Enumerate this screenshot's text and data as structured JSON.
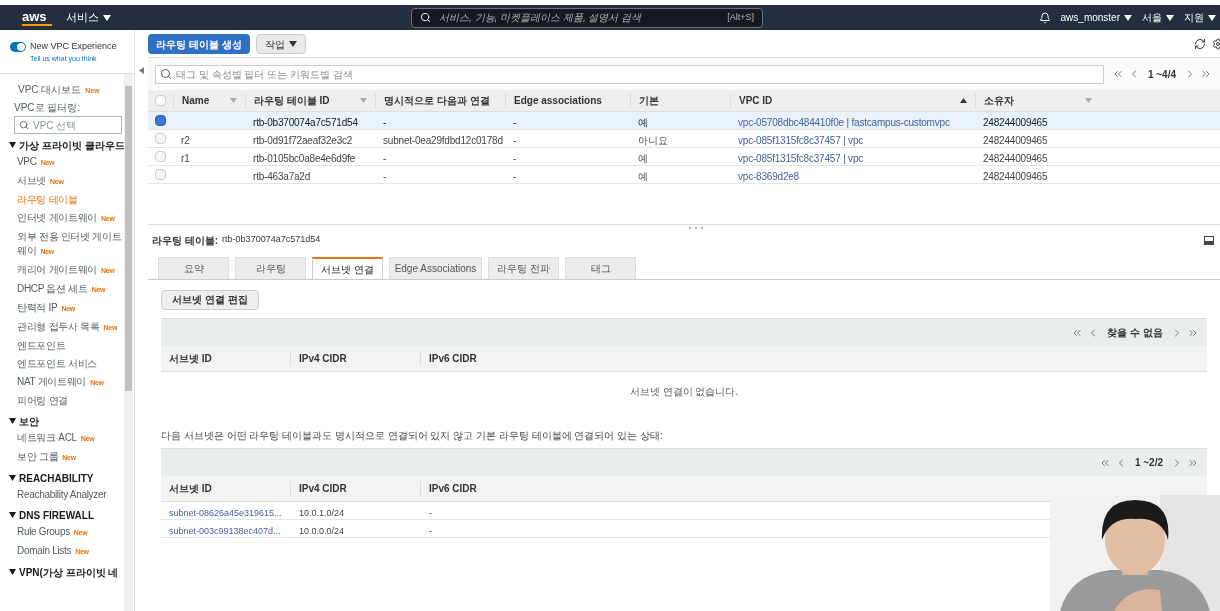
{
  "header": {
    "logo": "aws",
    "services": "서비스",
    "search_placeholder": "서비스, 기능, 마켓플레이스 제품, 설명서 검색",
    "shortcut": "[Alt+S]",
    "user": "aws_monster",
    "region": "서울",
    "support": "지원"
  },
  "sidebar": {
    "toggle": {
      "label": "New VPC Experience",
      "on": true
    },
    "feedback": "Tell us what you think",
    "top_items": [
      {
        "label": "VPC 대시보드",
        "badge": "New"
      }
    ],
    "filter_label": "VPC로 필터링:",
    "filter_placeholder": "VPC 선택",
    "sections": [
      {
        "title": "가상 프라이빗 클라우드",
        "expanded": true,
        "items": [
          {
            "label": "VPC",
            "badge": "New",
            "selected": false
          },
          {
            "label": "서브넷",
            "badge": "New",
            "selected": false
          },
          {
            "label": "라우팅 테이블",
            "selected": true
          },
          {
            "label": "인터넷 게이트웨이",
            "badge": "New",
            "selected": false
          },
          {
            "label": "외부 전용 인터넷 게이트웨이",
            "badge": "New",
            "selected": false
          },
          {
            "label": "캐리어 게이트웨이",
            "badge": "New",
            "selected": false
          },
          {
            "label": "DHCP 옵션 세트",
            "badge": "New",
            "selected": false
          },
          {
            "label": "탄력적 IP",
            "badge": "New",
            "selected": false
          },
          {
            "label": "관리형 접두사 목록",
            "badge": "New",
            "selected": false
          },
          {
            "label": "엔드포인트",
            "selected": false
          },
          {
            "label": "엔드포인트 서비스",
            "selected": false
          },
          {
            "label": "NAT 게이트웨이",
            "badge": "New",
            "selected": false
          },
          {
            "label": "피어링 연결",
            "selected": false
          }
        ]
      },
      {
        "title": "보안",
        "expanded": true,
        "items": [
          {
            "label": "네트워크 ACL",
            "badge": "New",
            "selected": false
          },
          {
            "label": "보안 그룹",
            "badge": "New",
            "selected": false
          }
        ]
      },
      {
        "title": "REACHABILITY",
        "expanded": true,
        "items": [
          {
            "label": "Reachability Analyzer",
            "selected": false
          }
        ]
      },
      {
        "title": "DNS FIREWALL",
        "expanded": true,
        "items": [
          {
            "label": "Rule Groups",
            "badge": "New",
            "selected": false
          },
          {
            "label": "Domain Lists",
            "badge": "New",
            "selected": false
          }
        ]
      },
      {
        "title": "VPN(가상 프라이빗 네",
        "expanded": true
      }
    ]
  },
  "toolbar": {
    "create_button": "라우팅 테이블 생성",
    "actions_button": "작업"
  },
  "filter": {
    "placeholder": "태그 및 속성별 필터 또는 키워드별 검색",
    "pagination": "1 ~4/4"
  },
  "table": {
    "all_selected": false,
    "columns": [
      {
        "label": "Name",
        "menu": true,
        "sorted": false
      },
      {
        "label": "라우팅 테이블 ID",
        "menu": true,
        "sorted": false
      },
      {
        "label": "명시적으로 다음과 연결",
        "menu": false,
        "sorted": false
      },
      {
        "label": "Edge associations",
        "menu": false,
        "sorted": false
      },
      {
        "label": "기본",
        "menu": false,
        "sorted": false
      },
      {
        "label": "VPC ID",
        "menu": false,
        "sorted": true
      },
      {
        "label": "소유자",
        "menu": true,
        "sorted": false
      }
    ],
    "rows": [
      {
        "selected": true,
        "cells": [
          "",
          "rtb-0b370074a7c571d54",
          "-",
          "-",
          "예",
          "vpc-05708dbc484410f0e | fastcampus-customvpc",
          "248244009465"
        ]
      },
      {
        "selected": false,
        "cells": [
          "r2",
          "rtb-0d91f72aeaf32e3c2",
          "subnet-0ea29fdbd12c0178d",
          "-",
          "아니요",
          "vpc-085f1315fc8c37457 | vpc",
          "248244009465"
        ]
      },
      {
        "selected": false,
        "cells": [
          "r1",
          "rtb-0105bc0a8e4e6d9fe",
          "-",
          "-",
          "예",
          "vpc-085f1315fc8c37457 | vpc",
          "248244009465"
        ]
      },
      {
        "selected": false,
        "cells": [
          "",
          "rtb-463a7a2d",
          "-",
          "-",
          "예",
          "vpc-8369d2e8",
          "248244009465"
        ]
      }
    ]
  },
  "detail": {
    "label": "라우팅 테이블:",
    "value": "rtb-0b370074a7c571d54",
    "tabs": [
      {
        "label": "요약",
        "selected": false
      },
      {
        "label": "라우팅",
        "selected": false
      },
      {
        "label": "서브넷 연결",
        "selected": true
      },
      {
        "label": "Edge Associations",
        "selected": false
      },
      {
        "label": "라우팅 전파",
        "selected": false
      },
      {
        "label": "태그",
        "selected": false
      }
    ],
    "edit_button": "서브넷 연결 편집",
    "associated": {
      "pagination": "찾을 수 없음",
      "columns": [
        "서브넷 ID",
        "IPv4 CIDR",
        "IPv6 CIDR"
      ],
      "empty_message": "서브넷 연결이 없습니다."
    },
    "note": "다음 서브넷은 어떤 라우팅 테이블과도 명시적으로 연결되어 있지 않고 기본 라우팅 테이블에 연결되어 있는 상태:",
    "implicit": {
      "pagination": "1 ~2/2",
      "columns": [
        "서브넷 ID",
        "IPv4 CIDR",
        "IPv6 CIDR"
      ],
      "rows": [
        [
          "subnet-08626a45e319615...",
          "10.0.1.0/24",
          "-"
        ],
        [
          "subnet-003c99138ec407d...",
          "10.0.0.0/24",
          "-"
        ]
      ]
    }
  }
}
